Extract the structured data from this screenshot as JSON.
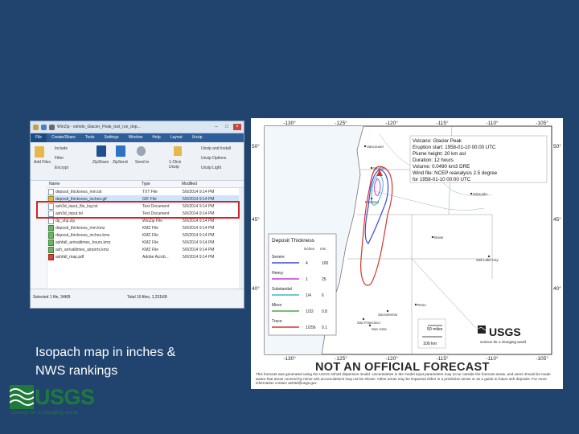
{
  "caption": "Isopach map in inches & NWS rankings",
  "logo": {
    "name": "USGS",
    "tagline": "science for a changing world"
  },
  "winzip": {
    "title": "WinZip - eshide_Glacier_Peak_test_run_dep...",
    "tabs": [
      "File",
      "Create/Share",
      "Tools",
      "Settings",
      "Window",
      "Help",
      "Layout",
      "Unzip"
    ],
    "ribbon": {
      "add_files": "Add Files",
      "include": "Include",
      "filter": "Filter",
      "encrypt": "Encrypt",
      "zipshare": "ZipShare",
      "zipsend": "ZipSend",
      "send_to": "Send to",
      "one_click_unzip": "1-Click Unzip",
      "unzip_and_install": "Unzip and Install",
      "unzip_options": "Unzip Options",
      "unzip_light": "Unzip Light"
    },
    "columns": {
      "name": "Name",
      "type": "Type",
      "modified": "Modified"
    },
    "files": [
      {
        "name": "deposit_thickness_mm.txt",
        "type": "TXT File",
        "modified": "5/0/2014 9:14 PM",
        "icon": "txt"
      },
      {
        "name": "deposit_thickness_inches.gif",
        "type": "GIF File",
        "modified": "5/0/2014 9:14 PM",
        "icon": "gif",
        "selected": true
      },
      {
        "name": "ash3d_input_file_log.txt",
        "type": "Text Document",
        "modified": "5/0/2014 9:14 PM",
        "icon": "txt"
      },
      {
        "name": "ash3d_input.txt",
        "type": "Text Document",
        "modified": "5/0/2014 9:14 PM",
        "icon": "txt"
      },
      {
        "name": "dp_shp.zip",
        "type": "WinZip File",
        "modified": "5/0/2014 9:14 PM",
        "icon": "txt"
      },
      {
        "name": "deposit_thickness_mm.kmz",
        "type": "KMZ File",
        "modified": "5/0/2014 9:14 PM",
        "icon": "kmz"
      },
      {
        "name": "deposit_thickness_inches.kmz",
        "type": "KMZ File",
        "modified": "5/0/2014 9:14 PM",
        "icon": "kmz"
      },
      {
        "name": "ashfall_arrivaltimes_hours.kmz",
        "type": "KMZ File",
        "modified": "5/0/2014 9:14 PM",
        "icon": "kmz"
      },
      {
        "name": "ash_arrivaltimes_airports.kmz",
        "type": "KMZ File",
        "modified": "5/0/2014 9:14 PM",
        "icon": "kmz"
      },
      {
        "name": "ashfall_map.pdf",
        "type": "Adobe Acrob...",
        "modified": "5/0/2014 9:14 PM",
        "icon": "pdf"
      }
    ],
    "status_left": "Selected 1 file, 34KB",
    "status_right": "Total 10 files, 1,231KB"
  },
  "map": {
    "lon_labels": [
      "-130°",
      "-125°",
      "-120°",
      "-115°",
      "-110°",
      "-105°"
    ],
    "lat_labels": [
      "50°",
      "45°",
      "40°"
    ],
    "info": [
      "Volcano: Glacier Peak",
      "Eruption start: 1958-01-10 00:00 UTC",
      "Plume height: 20 km asl",
      "Duration: 12 hours",
      "Volume: 0.0490 km3 DRE",
      "Wind file: NCEP reanalysis 2.5 degree",
      "for 1958-01-10 00:00 UTC"
    ],
    "cities": [
      "Vancouver",
      "Seattle",
      "Portland",
      "Boise",
      "Salt Lake City",
      "Sacramento",
      "San Francisco",
      "Reno",
      "San Jose",
      "Missoula"
    ],
    "legend": {
      "title": "Deposit Thickness",
      "header": [
        "inches",
        "mm"
      ],
      "rows": [
        {
          "label": "Severe",
          "inches": "4",
          "mm": "100",
          "color": "#3b4bd8"
        },
        {
          "label": "Heavy",
          "inches": "1",
          "mm": "25",
          "color": "#c23ad6"
        },
        {
          "label": "Substantial",
          "inches": "1/4",
          "mm": "6",
          "color": "#39b8c9"
        },
        {
          "label": "Minor",
          "inches": "1/32",
          "mm": "0.8",
          "color": "#4aa84a"
        },
        {
          "label": "Trace",
          "inches": "1/256",
          "mm": "0.1",
          "color": "#d6362c"
        }
      ]
    },
    "scale": {
      "miles": "50 miles",
      "km": "100 km"
    },
    "usgs": {
      "name": "USGS",
      "tagline": "science for a changing world"
    },
    "forecast_title": "NOT AN OFFICIAL FORECAST",
    "forecast_note": "This forecast was generated using the USGS Ash3d dispersion model. Uncertainties in the model input parameters may occur outside the forecast areas, and users should be made aware that areas covered by minor ash accumulations may not be shown. Other areas may be impacted either in a predictive sense or as a guide to future ash deposits. For more information contact ash3d@usgs.gov"
  }
}
